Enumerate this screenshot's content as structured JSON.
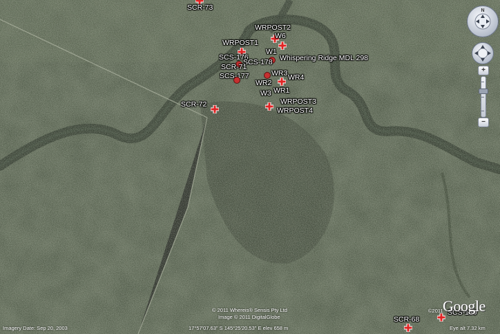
{
  "markers": [
    {
      "id": "SCR-73",
      "label": "SCR-73"
    },
    {
      "id": "WRPOST2",
      "label": "WRPOST2"
    },
    {
      "id": "W6",
      "label": "W6"
    },
    {
      "id": "WRPOST1",
      "label": "WRPOST1"
    },
    {
      "id": "W1",
      "label": "W1"
    },
    {
      "id": "WHISPER",
      "label": "Whispering Ridge MDL 298"
    },
    {
      "id": "SCS-176",
      "label": "SCS-176"
    },
    {
      "id": "SCS-178",
      "label": "SCS-178"
    },
    {
      "id": "SCR-71",
      "label": "SCR-71"
    },
    {
      "id": "WR3",
      "label": "WR3"
    },
    {
      "id": "WR4",
      "label": "WR4"
    },
    {
      "id": "SCS-177",
      "label": "SCS-177"
    },
    {
      "id": "WR2",
      "label": "WR2"
    },
    {
      "id": "W3",
      "label": "W3"
    },
    {
      "id": "WR1",
      "label": "WR1"
    },
    {
      "id": "SCR-72",
      "label": "SCR-72"
    },
    {
      "id": "WRPOST3",
      "label": "WRPOST3"
    },
    {
      "id": "WRPOST4",
      "label": "WRPOST4"
    },
    {
      "id": "SCR-68",
      "label": "SCR-68"
    },
    {
      "id": "SCS-180",
      "label": "SCS-180"
    }
  ],
  "status_bar": {
    "imagery_date": "Imagery Date: Sep 20, 2003",
    "copyright_1": "© 2011 Whereis® Sensis Pty Ltd",
    "copyright_2": "Image © 2011 DigitalGlobe",
    "coordinates": "17°57'07.63\" S     145°25'20.53\" E   elev  658 m",
    "eye_alt": "Eye alt   7.32 km",
    "copyright_small": "©2011"
  },
  "branding": {
    "logo": "Google"
  },
  "controls": {
    "zoom_in": "+",
    "zoom_out": "−",
    "nav_ring_icon": "compass-ring-icon",
    "look_ring_icon": "look-ring-icon"
  },
  "colors": {
    "marker_red": "#e02424",
    "river": "#1f2a1c",
    "terrain": "#3a4533"
  }
}
